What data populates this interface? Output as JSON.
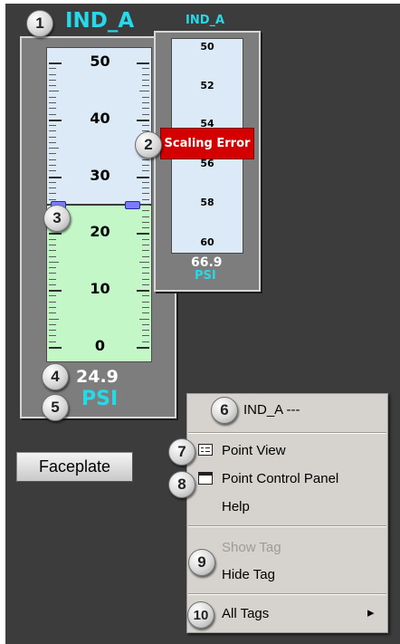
{
  "main_indicator": {
    "tag": "IND_A",
    "scale_labels": [
      "50",
      "40",
      "30",
      "20",
      "10",
      "0"
    ],
    "value": "24.9",
    "unit": "PSI",
    "fill_level": 24.9,
    "range": [
      0,
      50
    ]
  },
  "small_indicator": {
    "tag": "IND_A",
    "scale_labels": [
      "50",
      "52",
      "54",
      "56",
      "58",
      "60"
    ],
    "value": "66.9",
    "unit": "PSI",
    "error_text": "Scaling Error"
  },
  "faceplate_button": {
    "label": "Faceplate"
  },
  "context_menu": {
    "header": "IND_A ---",
    "items": {
      "point_view": "Point View",
      "point_control_panel": "Point Control Panel",
      "help": "Help",
      "show_tag": "Show Tag",
      "hide_tag": "Hide Tag",
      "all_tags": "All Tags"
    },
    "submenu_arrow": "▸"
  },
  "callouts": [
    "1",
    "2",
    "3",
    "4",
    "5",
    "6",
    "7",
    "8",
    "9",
    "10"
  ],
  "colors": {
    "background": "#3c3c3c",
    "frame": "#7d7d7d",
    "scale": "#dce9f7",
    "fill": "#c4f7c8",
    "tag_text": "#28d8e8",
    "error": "#d40000",
    "menu": "#d6d3ce"
  }
}
